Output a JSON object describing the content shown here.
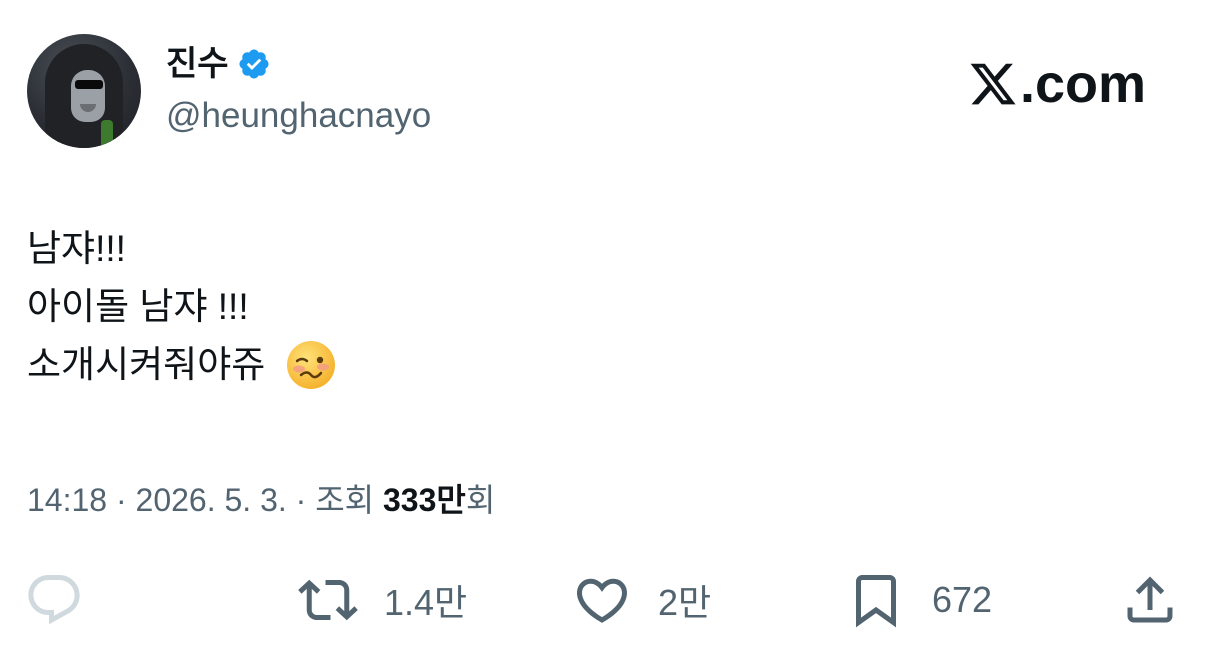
{
  "author": {
    "display_name": "진수",
    "handle": "@heunghacnayo",
    "verified": true
  },
  "brand": {
    "label": ".com",
    "logo": "x-logo-icon"
  },
  "tweet": {
    "lines": [
      "남쟈!!!",
      "아이돌 남쟈 !!!",
      "소개시켜줘야쥬"
    ],
    "emoji": "woozy-face"
  },
  "meta": {
    "time": "14:18",
    "date": "2026. 5. 3.",
    "views_prefix": "조회",
    "views_count": "333만",
    "views_suffix": "회",
    "separator": "·"
  },
  "actions": {
    "reply": {
      "icon": "reply-icon",
      "count": ""
    },
    "retweet": {
      "icon": "retweet-icon",
      "count": "1.4만"
    },
    "like": {
      "icon": "heart-icon",
      "count": "2만"
    },
    "bookmark": {
      "icon": "bookmark-icon",
      "count": "672"
    },
    "share": {
      "icon": "share-icon"
    }
  },
  "colors": {
    "verified_blue": "#1d9bf0",
    "secondary_text": "#536471",
    "reply_icon_gray": "#cfd9de"
  }
}
